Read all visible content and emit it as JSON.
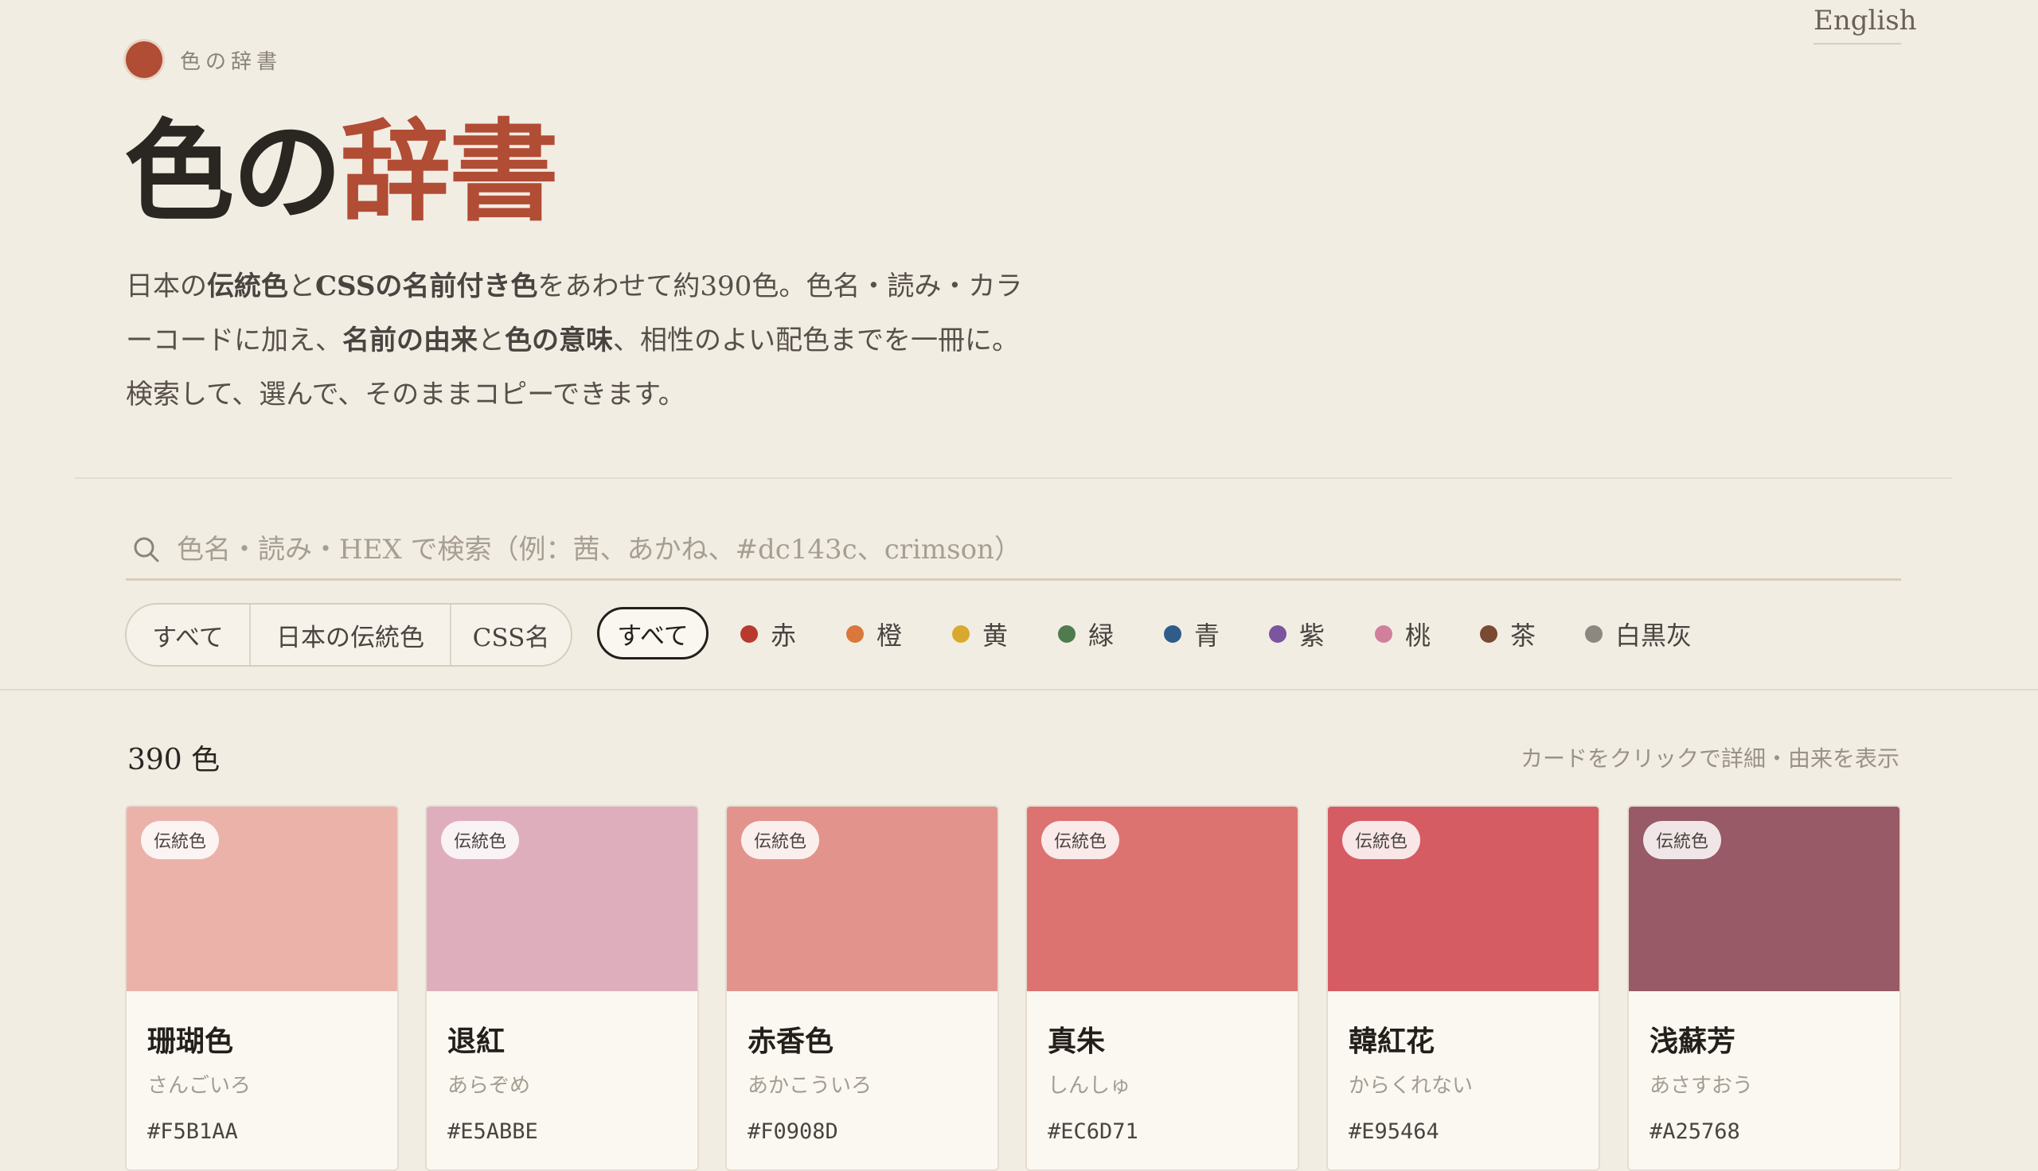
{
  "header": {
    "brand_name": "色の辞書",
    "language_link": "English",
    "title_part1": "色の",
    "title_part2": "辞書"
  },
  "description": {
    "line1": [
      {
        "t": "日本の",
        "b": false
      },
      {
        "t": "伝統色",
        "b": true
      },
      {
        "t": "と",
        "b": false
      },
      {
        "t": "CSSの名前付き色",
        "b": true
      },
      {
        "t": "をあわせて約390色。色名・読み・カラ",
        "b": false
      }
    ],
    "line2": [
      {
        "t": "ーコードに加え、",
        "b": false
      },
      {
        "t": "名前の由来",
        "b": true
      },
      {
        "t": "と",
        "b": false
      },
      {
        "t": "色の意味",
        "b": true
      },
      {
        "t": "、相性のよい配色までを一冊に。",
        "b": false
      }
    ],
    "line3": [
      {
        "t": "検索して、選んで、そのままコピーできます。",
        "b": false
      }
    ]
  },
  "search": {
    "placeholder": "色名・読み・HEX で検索（例：茜、あかね、#dc143c、crimson）",
    "value": ""
  },
  "category_filter": {
    "options": [
      "すべて",
      "日本の伝統色",
      "CSS名"
    ],
    "selected": "すべて"
  },
  "hue_filter": {
    "all_label": "すべて",
    "selected": "すべて",
    "hues": [
      {
        "label": "赤",
        "color": "#b83a2e"
      },
      {
        "label": "橙",
        "color": "#d9783a"
      },
      {
        "label": "黄",
        "color": "#d9a92f"
      },
      {
        "label": "緑",
        "color": "#4f7b4f"
      },
      {
        "label": "青",
        "color": "#2f5d8a"
      },
      {
        "label": "紫",
        "color": "#7b55a0"
      },
      {
        "label": "桃",
        "color": "#d1809b"
      },
      {
        "label": "茶",
        "color": "#7a4a33"
      },
      {
        "label": "白黒灰",
        "color": "#8c8880"
      }
    ]
  },
  "results": {
    "count_label": "390 色",
    "hint": "カードをクリックで詳細・由来を表示"
  },
  "cards": [
    {
      "badge": "伝統色",
      "name": "珊瑚色",
      "reading": "さんごいろ",
      "hex": "#F5B1AA",
      "color": "#ebb2aa"
    },
    {
      "badge": "伝統色",
      "name": "退紅",
      "reading": "あらぞめ",
      "hex": "#E5ABBE",
      "color": "#dfaebd"
    },
    {
      "badge": "伝統色",
      "name": "赤香色",
      "reading": "あかこういろ",
      "hex": "#F0908D",
      "color": "#e2948c"
    },
    {
      "badge": "伝統色",
      "name": "真朱",
      "reading": "しんしゅ",
      "hex": "#EC6D71",
      "color": "#dc7371"
    },
    {
      "badge": "伝統色",
      "name": "韓紅花",
      "reading": "からくれない",
      "hex": "#E95464",
      "color": "#d65c64"
    },
    {
      "badge": "伝統色",
      "name": "浅蘇芳",
      "reading": "あさすおう",
      "hex": "#A25768",
      "color": "#985a66"
    }
  ]
}
